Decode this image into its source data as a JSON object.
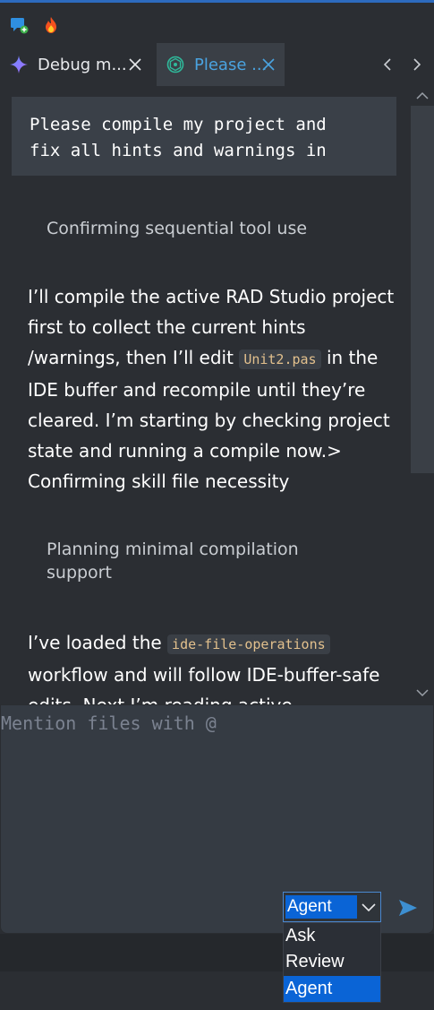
{
  "tabs": [
    {
      "label": "Debug m...",
      "icon": "sparkle-icon"
    },
    {
      "label": "Please ...",
      "icon": "openai-icon"
    }
  ],
  "conversation": {
    "prompt": "Please compile my project and\nfix all hints and warnings in",
    "thinking_1": "Confirming sequential tool use",
    "para_1": {
      "before": "I’ll compile the active RAD Studio project first to collect the current hints /warnings, then I’ll edit ",
      "code": "Unit2.pas",
      "after": " in the IDE buffer and recompile until they’re cleared. I’m starting by checking project state and running a compile now.> Confirming skill file necessity"
    },
    "thinking_2": "Planning minimal compilation support",
    "para_2": {
      "before": "I’ve loaded the ",
      "code": "ide-file-operations",
      "after": " workflow and will follow IDE-buffer-safe edits. Next I’m reading active"
    }
  },
  "input": {
    "placeholder": "Mention files with @"
  },
  "mode": {
    "selected": "Agent",
    "options": [
      "Ask",
      "Review",
      "Agent"
    ]
  },
  "colors": {
    "accent": "#0a64d6",
    "active_tab_text": "#4aa3e0",
    "code_text": "#e2c08d",
    "send": "#3d8fd1"
  }
}
